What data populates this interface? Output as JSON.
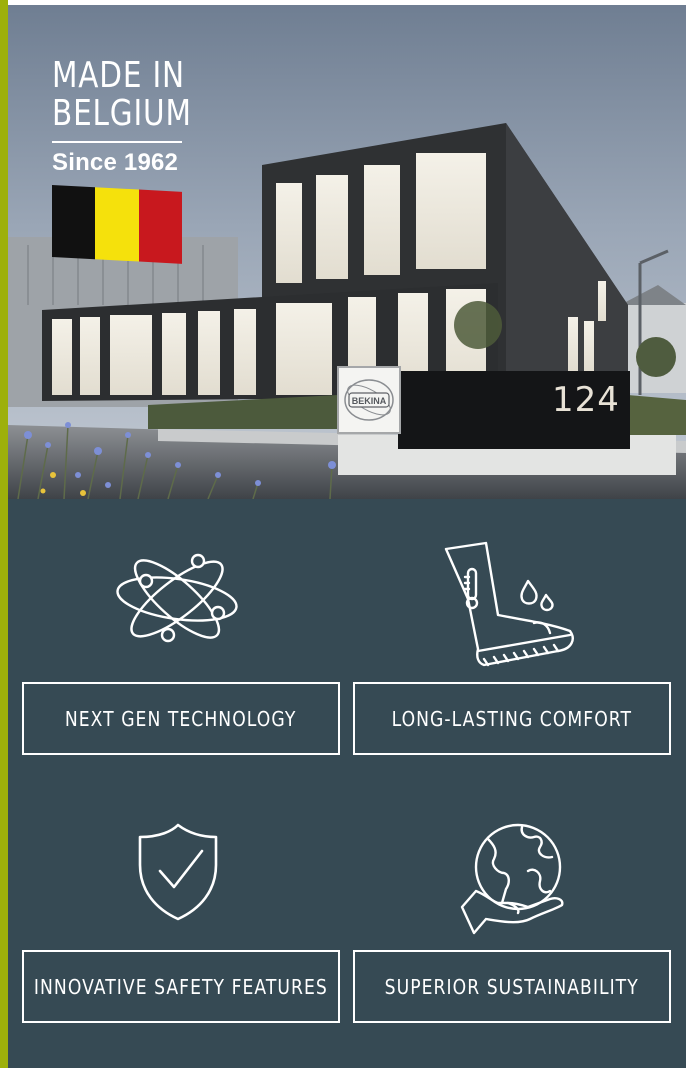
{
  "badge": {
    "made_in": "MADE IN",
    "country": "BELGIUM",
    "since": "Since 1962",
    "flag_colors": [
      "#111111",
      "#f5e10c",
      "#c8181e"
    ]
  },
  "building": {
    "sign_logo": "BEKINA",
    "sign_number": "124"
  },
  "features": [
    {
      "label": "NEXT GEN TECHNOLOGY",
      "icon": "atom-icon"
    },
    {
      "label": "LONG-LASTING COMFORT",
      "icon": "boot-icon"
    },
    {
      "label": "INNOVATIVE SAFETY FEATURES",
      "icon": "shield-check-icon"
    },
    {
      "label": "SUPERIOR SUSTAINABILITY",
      "icon": "globe-hand-icon"
    }
  ],
  "colors": {
    "accent": "#9db00b",
    "panel": "#364a54"
  }
}
